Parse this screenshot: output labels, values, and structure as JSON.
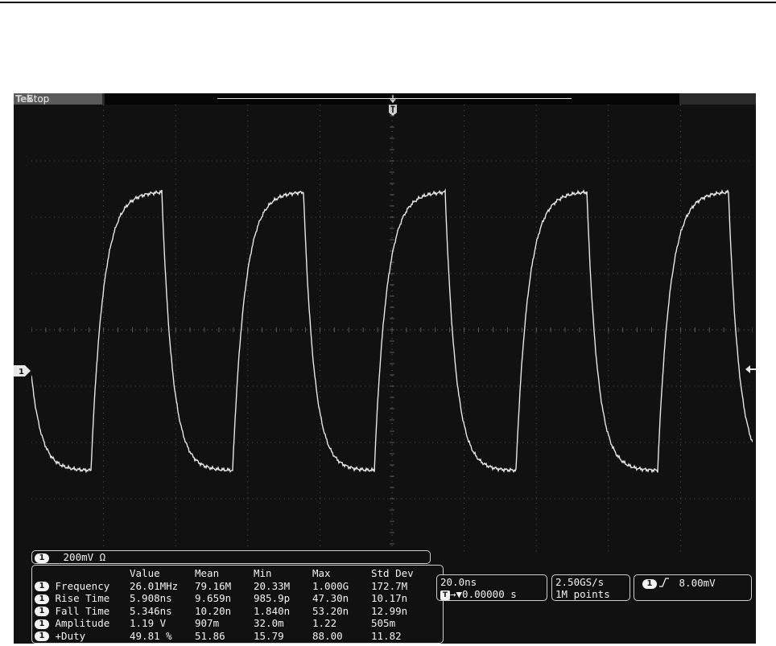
{
  "status": {
    "brand": "Tek",
    "acq_state": "Stop"
  },
  "channel": {
    "id": "1",
    "scale": "200mV Ω"
  },
  "measurements": {
    "headers": [
      "",
      "Value",
      "Mean",
      "Min",
      "Max",
      "Std Dev"
    ],
    "rows": [
      {
        "name": "Frequency",
        "value": "26.01MHz",
        "mean": "79.16M",
        "min": "20.33M",
        "max": "1.000G",
        "std": "172.7M"
      },
      {
        "name": "Rise Time",
        "value": "5.908ns",
        "mean": "9.659n",
        "min": "985.9p",
        "max": "47.30n",
        "std": "10.17n"
      },
      {
        "name": "Fall Time",
        "value": "5.346ns",
        "mean": "10.20n",
        "min": "1.840n",
        "max": "53.20n",
        "std": "12.99n"
      },
      {
        "name": "Amplitude",
        "value": "1.19 V",
        "mean": "907m",
        "min": "32.0m",
        "max": "1.22",
        "std": "505m"
      },
      {
        "name": "+Duty",
        "value": "49.81 %",
        "mean": "51.86",
        "min": "15.79",
        "max": "88.00",
        "std": "11.82"
      }
    ]
  },
  "horizontal": {
    "scale": "20.0ns",
    "delay": "→▼0.00000 s"
  },
  "acquisition": {
    "sample_rate": "2.50GS/s",
    "record_length": "1M points"
  },
  "trigger": {
    "slope_icon": "rising-edge-icon",
    "level": "8.00mV"
  },
  "colors": {
    "screen": "#111111",
    "trace": "#e6e6e6",
    "grid": "#6a6a6a"
  }
}
